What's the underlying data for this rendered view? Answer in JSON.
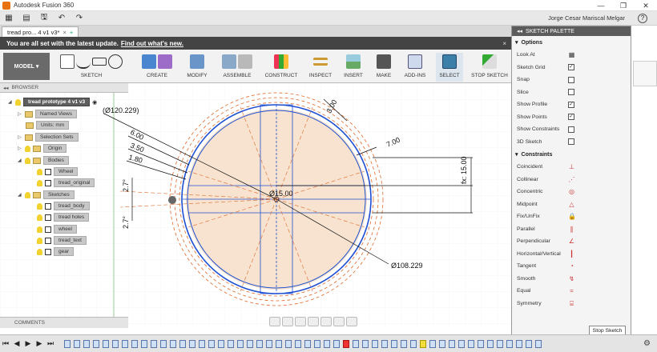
{
  "app": {
    "title": "Autodesk Fusion 360"
  },
  "window": {
    "minimize": "—",
    "restore": "❐",
    "close": "✕"
  },
  "qat": {
    "user": "Jorge Cesar Mariscal Melgar",
    "help": "?"
  },
  "doc_tab": {
    "label": "tread pro... 4 v1 v3*",
    "close": "×",
    "add": "+"
  },
  "banner": {
    "text": "You are all set with the latest update.",
    "link": "Find out what's new.",
    "close": "×"
  },
  "ribbon": {
    "workspace": "MODEL",
    "groups": [
      "SKETCH",
      "CREATE",
      "MODIFY",
      "ASSEMBLE",
      "CONSTRUCT",
      "INSPECT",
      "INSERT",
      "MAKE",
      "ADD-INS",
      "SELECT",
      "STOP SKETCH"
    ]
  },
  "browser": {
    "header": "BROWSER",
    "root": "tread prototype 4 v1 v3",
    "items": [
      "Named Views",
      "Units: mm",
      "Selection Sets",
      "Origin",
      "Bodies",
      "Wheel",
      "tread_original",
      "Sketches",
      "tread_body",
      "tread holes",
      "wheel",
      "tread_text",
      "gear"
    ]
  },
  "comments": {
    "label": "COMMENTS"
  },
  "sketch": {
    "dims": [
      "(Ø120.229)",
      "3.00",
      "6.00",
      "3.50",
      "1.80",
      "7.00",
      "15.00",
      "Ø15.00",
      "2.7°",
      "2.7°",
      "Ø108.229"
    ],
    "fx": "fx: 15.00"
  },
  "palette": {
    "header": "SKETCH PALETTE",
    "options_title": "Options",
    "options": [
      {
        "label": "Look At",
        "control": "icon",
        "icon": "look-at-icon",
        "glyph": "▦"
      },
      {
        "label": "Sketch Grid",
        "control": "checkbox",
        "checked": true
      },
      {
        "label": "Snap",
        "control": "checkbox",
        "checked": false
      },
      {
        "label": "Slice",
        "control": "checkbox",
        "checked": false
      },
      {
        "label": "Show Profile",
        "control": "checkbox",
        "checked": true
      },
      {
        "label": "Show Points",
        "control": "checkbox",
        "checked": true
      },
      {
        "label": "Show Constraints",
        "control": "checkbox",
        "checked": false
      },
      {
        "label": "3D Sketch",
        "control": "checkbox",
        "checked": false
      }
    ],
    "constraints_title": "Constraints",
    "constraints": [
      {
        "label": "Coincident",
        "glyph": "⊥",
        "icon": "coincident-icon"
      },
      {
        "label": "Collinear",
        "glyph": "⋰",
        "icon": "collinear-icon"
      },
      {
        "label": "Concentric",
        "glyph": "◎",
        "icon": "concentric-icon"
      },
      {
        "label": "Midpoint",
        "glyph": "△",
        "icon": "midpoint-icon"
      },
      {
        "label": "Fix/UnFix",
        "glyph": "🔒",
        "icon": "fix-icon"
      },
      {
        "label": "Parallel",
        "glyph": "∥",
        "icon": "parallel-icon"
      },
      {
        "label": "Perpendicular",
        "glyph": "∠",
        "icon": "perpendicular-icon"
      },
      {
        "label": "Horizontal/Vertical",
        "glyph": "┃",
        "icon": "horizontal-vertical-icon"
      },
      {
        "label": "Tangent",
        "glyph": "◔",
        "icon": "tangent-icon"
      },
      {
        "label": "Smooth",
        "glyph": "↯",
        "icon": "smooth-icon"
      },
      {
        "label": "Equal",
        "glyph": "=",
        "icon": "equal-icon"
      },
      {
        "label": "Symmetry",
        "glyph": "⌸",
        "icon": "symmetry-icon"
      }
    ],
    "stop_button": "Stop Sketch"
  },
  "colors": {
    "accent": "#e8730c",
    "sketch_blue": "#1f4fd1",
    "construction": "#e06a2b",
    "profile_fill": "#f7e3cf"
  }
}
